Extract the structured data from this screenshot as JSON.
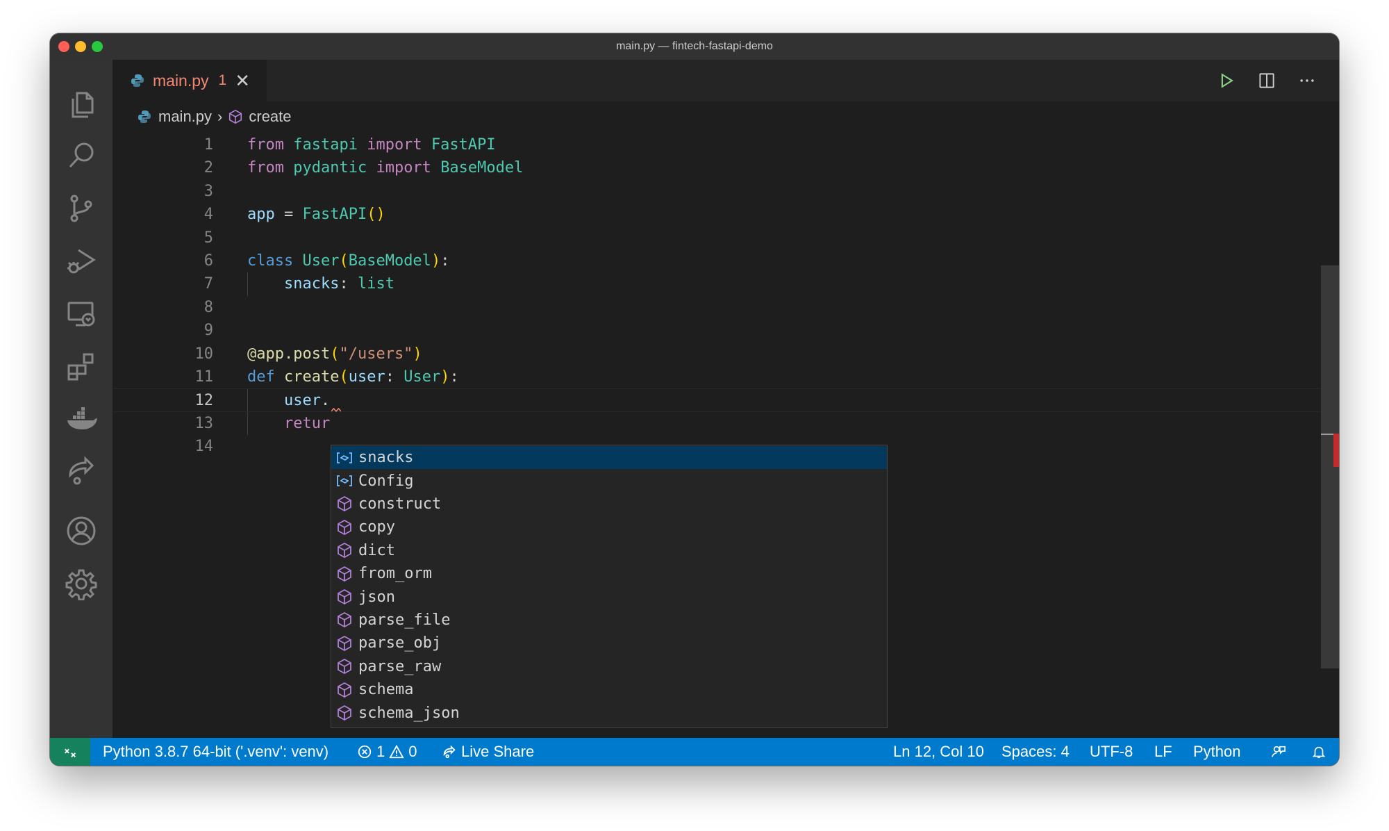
{
  "window": {
    "title": "main.py — fintech-fastapi-demo"
  },
  "tab": {
    "name": "main.py",
    "problems": "1",
    "close_glyph": "✕"
  },
  "breadcrumb": {
    "file": "main.py",
    "separator": "›",
    "symbol": "create"
  },
  "code": {
    "lines": [
      {
        "n": "1",
        "tokens": [
          [
            "kw",
            "from"
          ],
          [
            "punc",
            " "
          ],
          [
            "mod",
            "fastapi"
          ],
          [
            "punc",
            " "
          ],
          [
            "kw",
            "import"
          ],
          [
            "punc",
            " "
          ],
          [
            "cls",
            "FastAPI"
          ]
        ]
      },
      {
        "n": "2",
        "tokens": [
          [
            "kw",
            "from"
          ],
          [
            "punc",
            " "
          ],
          [
            "mod",
            "pydantic"
          ],
          [
            "punc",
            " "
          ],
          [
            "kw",
            "import"
          ],
          [
            "punc",
            " "
          ],
          [
            "cls",
            "BaseModel"
          ]
        ]
      },
      {
        "n": "3",
        "tokens": []
      },
      {
        "n": "4",
        "tokens": [
          [
            "var",
            "app"
          ],
          [
            "punc",
            " = "
          ],
          [
            "cls",
            "FastAPI"
          ],
          [
            "paren",
            "()"
          ]
        ]
      },
      {
        "n": "5",
        "tokens": []
      },
      {
        "n": "6",
        "tokens": [
          [
            "kw2",
            "class"
          ],
          [
            "punc",
            " "
          ],
          [
            "cls",
            "User"
          ],
          [
            "paren",
            "("
          ],
          [
            "cls",
            "BaseModel"
          ],
          [
            "paren",
            ")"
          ],
          [
            "punc",
            ":"
          ]
        ]
      },
      {
        "n": "7",
        "tokens": [
          [
            "punc",
            "    "
          ],
          [
            "var",
            "snacks"
          ],
          [
            "punc",
            ": "
          ],
          [
            "cls",
            "list"
          ]
        ]
      },
      {
        "n": "8",
        "tokens": []
      },
      {
        "n": "9",
        "tokens": []
      },
      {
        "n": "10",
        "tokens": [
          [
            "fn",
            "@app.post"
          ],
          [
            "paren",
            "("
          ],
          [
            "str",
            "\"/users\""
          ],
          [
            "paren",
            ")"
          ]
        ]
      },
      {
        "n": "11",
        "tokens": [
          [
            "kw2",
            "def"
          ],
          [
            "punc",
            " "
          ],
          [
            "fn",
            "create"
          ],
          [
            "paren",
            "("
          ],
          [
            "var",
            "user"
          ],
          [
            "punc",
            ": "
          ],
          [
            "cls",
            "User"
          ],
          [
            "paren",
            ")"
          ],
          [
            "punc",
            ":"
          ]
        ]
      },
      {
        "n": "12",
        "tokens": [
          [
            "punc",
            "    "
          ],
          [
            "var",
            "user"
          ],
          [
            "punc",
            "."
          ]
        ]
      },
      {
        "n": "13",
        "tokens": [
          [
            "punc",
            "    "
          ],
          [
            "kw",
            "retur"
          ]
        ]
      },
      {
        "n": "14",
        "tokens": []
      }
    ],
    "active_line": "12"
  },
  "suggestions": [
    {
      "label": "snacks",
      "kind": "field-icon",
      "selected": true
    },
    {
      "label": "Config",
      "kind": "field-icon",
      "selected": false
    },
    {
      "label": "construct",
      "kind": "method-icon",
      "selected": false
    },
    {
      "label": "copy",
      "kind": "method-icon",
      "selected": false
    },
    {
      "label": "dict",
      "kind": "method-icon",
      "selected": false
    },
    {
      "label": "from_orm",
      "kind": "method-icon",
      "selected": false
    },
    {
      "label": "json",
      "kind": "method-icon",
      "selected": false
    },
    {
      "label": "parse_file",
      "kind": "method-icon",
      "selected": false
    },
    {
      "label": "parse_obj",
      "kind": "method-icon",
      "selected": false
    },
    {
      "label": "parse_raw",
      "kind": "method-icon",
      "selected": false
    },
    {
      "label": "schema",
      "kind": "method-icon",
      "selected": false
    },
    {
      "label": "schema_json",
      "kind": "method-icon",
      "selected": false
    }
  ],
  "activity": [
    "files-icon",
    "search-icon",
    "source-control-icon",
    "run-debug-icon",
    "remote-explorer-icon",
    "extensions-icon",
    "docker-icon",
    "live-share-icon",
    "accounts-icon",
    "settings-gear-icon"
  ],
  "status": {
    "interpreter": "Python 3.8.7 64-bit ('.venv': venv)",
    "errors": "1",
    "warnings": "0",
    "live_share": "Live Share",
    "position": "Ln 12, Col 10",
    "spaces": "Spaces: 4",
    "encoding": "UTF-8",
    "eol": "LF",
    "language": "Python"
  },
  "colors": {
    "statusbar": "#007acc",
    "remote": "#16825d",
    "tab_error": "#f48771",
    "selection": "#04395e",
    "method_icon": "#b180d7",
    "field_icon": "#75beff"
  }
}
